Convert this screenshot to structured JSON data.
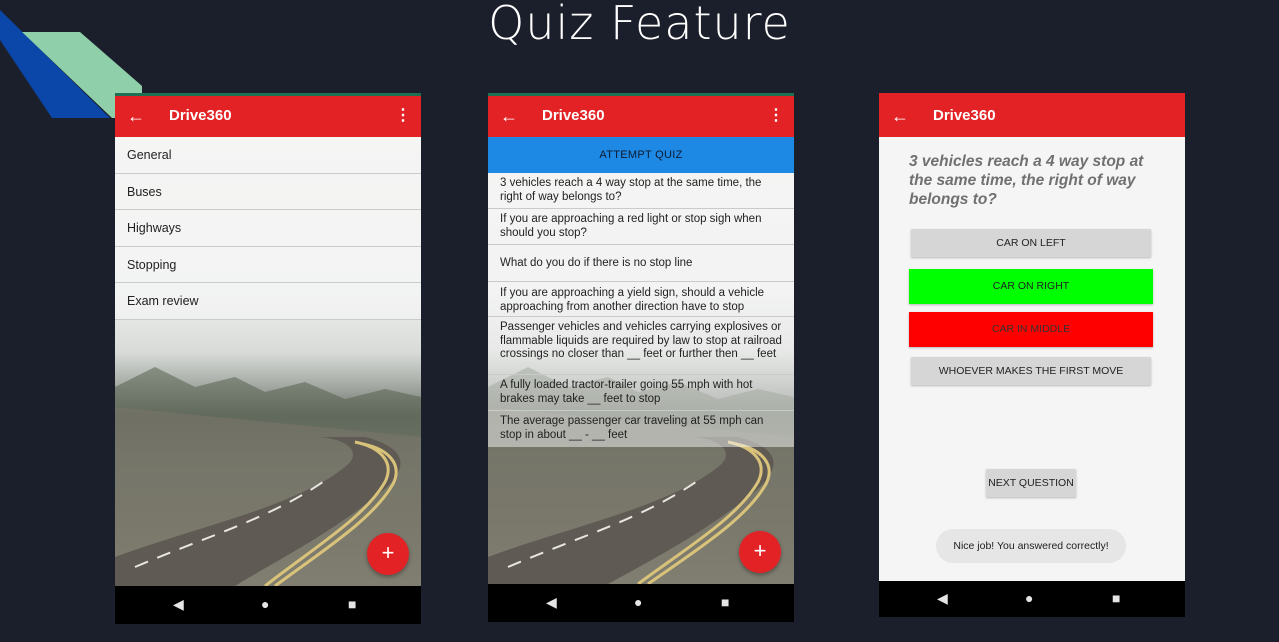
{
  "slide": {
    "title": "Quiz Feature",
    "background_color": "#1b1f2b",
    "accent_colors": [
      "#0a47a8",
      "#8fcfa9"
    ]
  },
  "app": {
    "name": "Drive360",
    "appbar_color": "#e32225",
    "back_icon": "arrow-left-icon",
    "more_icon": "more-vertical-icon"
  },
  "screen1": {
    "categories": [
      "General",
      "Buses",
      "Highways",
      "Stopping",
      "Exam review"
    ],
    "fab_label": "+"
  },
  "screen2": {
    "attempt_label": "ATTEMPT QUIZ",
    "questions": [
      "3 vehicles reach a 4 way stop at the same time, the right of way belongs to?",
      "If you are approaching a red light or stop sigh when should you stop?",
      "What do you do if there is no stop line",
      "If you are approaching a yield sign, should a vehicle approaching from another direction have to stop",
      "Passenger vehicles and vehicles carrying explosives or flammable liquids are required by law to stop at railroad crossings no closer than __ feet or further then __ feet",
      "A fully loaded tractor-trailer going 55 mph with hot brakes may take __ feet to stop",
      "The average passenger car traveling at 55 mph can stop in about __ - __ feet"
    ],
    "fab_label": "+"
  },
  "screen3": {
    "question": "3 vehicles reach a 4 way stop at the same time, the right of way belongs to?",
    "answers": [
      "CAR ON LEFT",
      "CAR ON RIGHT",
      "CAR IN MIDDLE",
      "WHOEVER MAKES THE FIRST MOVE"
    ],
    "answer_states": [
      "default",
      "correct",
      "wrong",
      "default"
    ],
    "next_label": "NEXT QUESTION",
    "toast": "Nice job! You answered correctly!"
  },
  "navbar": {
    "back": "◀",
    "home": "●",
    "recents": "■"
  }
}
